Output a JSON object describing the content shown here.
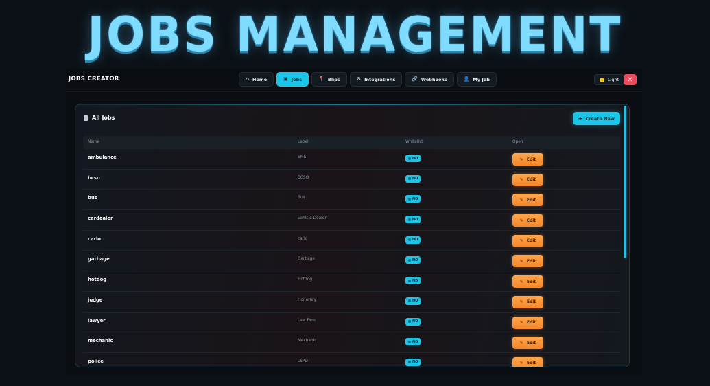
{
  "banner": {
    "title": "JOBS MANAGEMENT"
  },
  "app": {
    "brand": "JOBS CREATOR",
    "nav": [
      {
        "label": "Home",
        "icon": "home-icon",
        "glyph": "⌂",
        "active": false
      },
      {
        "label": "Jobs",
        "icon": "briefcase-icon",
        "glyph": "▣",
        "active": true
      },
      {
        "label": "Blips",
        "icon": "pin-icon",
        "glyph": "📍",
        "active": false
      },
      {
        "label": "Integrations",
        "icon": "gear-icon",
        "glyph": "⚙",
        "active": false
      },
      {
        "label": "Webhooks",
        "icon": "link-icon",
        "glyph": "🔗",
        "active": false
      },
      {
        "label": "My Job",
        "icon": "user-icon",
        "glyph": "👤",
        "active": false
      }
    ],
    "theme_label": "Light",
    "close_glyph": "✕"
  },
  "panel": {
    "title": "All Jobs",
    "create_label": "Create New",
    "columns": [
      "Name",
      "Label",
      "Whitelist",
      "Open"
    ],
    "rows": [
      {
        "name": "ambulance",
        "label": "EMS",
        "whitelist": "NO",
        "action": "Edit"
      },
      {
        "name": "bcso",
        "label": "BCSO",
        "whitelist": "NO",
        "action": "Edit"
      },
      {
        "name": "bus",
        "label": "Bus",
        "whitelist": "NO",
        "action": "Edit"
      },
      {
        "name": "cardealer",
        "label": "Vehicle Dealer",
        "whitelist": "NO",
        "action": "Edit"
      },
      {
        "name": "carlo",
        "label": "carlo",
        "whitelist": "NO",
        "action": "Edit"
      },
      {
        "name": "garbage",
        "label": "Garbage",
        "whitelist": "NO",
        "action": "Edit"
      },
      {
        "name": "hotdog",
        "label": "Hotdog",
        "whitelist": "NO",
        "action": "Edit"
      },
      {
        "name": "judge",
        "label": "Honorary",
        "whitelist": "NO",
        "action": "Edit"
      },
      {
        "name": "lawyer",
        "label": "Law Firm",
        "whitelist": "NO",
        "action": "Edit"
      },
      {
        "name": "mechanic",
        "label": "Mechanic",
        "whitelist": "NO",
        "action": "Edit"
      },
      {
        "name": "police",
        "label": "LSPD",
        "whitelist": "NO",
        "action": "Edit"
      }
    ]
  },
  "colors": {
    "accent": "#19c6ea",
    "edit": "#f4862b",
    "close": "#ef4a5d",
    "banner": "#7fdcff"
  }
}
